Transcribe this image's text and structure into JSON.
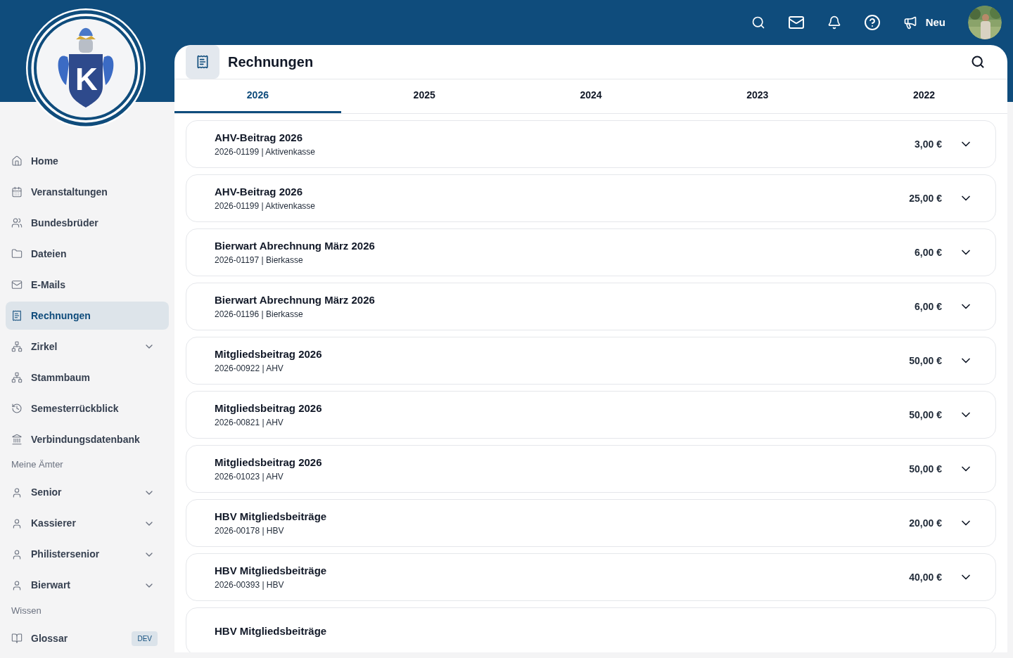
{
  "logo": {
    "letter": "K"
  },
  "sidebar": {
    "sections": [
      {
        "items": [
          {
            "label": "Home",
            "selected": false,
            "expandable": false
          },
          {
            "label": "Veranstaltungen",
            "selected": false,
            "expandable": false
          },
          {
            "label": "Bundesbrüder",
            "selected": false,
            "expandable": false
          },
          {
            "label": "Dateien",
            "selected": false,
            "expandable": false
          },
          {
            "label": "E-Mails",
            "selected": false,
            "expandable": false
          },
          {
            "label": "Rechnungen",
            "selected": true,
            "expandable": false
          },
          {
            "label": "Zirkel",
            "selected": false,
            "expandable": true
          },
          {
            "label": "Stammbaum",
            "selected": false,
            "expandable": false
          },
          {
            "label": "Semesterrückblick",
            "selected": false,
            "expandable": false
          },
          {
            "label": "Verbindungsdatenbank",
            "selected": false,
            "expandable": false
          }
        ]
      },
      {
        "heading": "Meine Ämter",
        "items": [
          {
            "label": "Senior",
            "selected": false,
            "expandable": true
          },
          {
            "label": "Kassierer",
            "selected": false,
            "expandable": true
          },
          {
            "label": "Philistersenior",
            "selected": false,
            "expandable": true
          },
          {
            "label": "Bierwart",
            "selected": false,
            "expandable": true
          }
        ]
      },
      {
        "heading": "Wissen",
        "items": [
          {
            "label": "Glossar",
            "selected": false,
            "expandable": false,
            "badge": "DEV"
          }
        ]
      }
    ]
  },
  "topbar": {
    "new_label": "Neu"
  },
  "page": {
    "title": "Rechnungen",
    "tabs": [
      {
        "label": "2026",
        "selected": true
      },
      {
        "label": "2025",
        "selected": false
      },
      {
        "label": "2024",
        "selected": false
      },
      {
        "label": "2023",
        "selected": false
      },
      {
        "label": "2022",
        "selected": false
      }
    ],
    "invoices": [
      {
        "title": "AHV-Beitrag 2026",
        "subtitle": "2026-01199 | Aktivenkasse",
        "amount": "3,00 €"
      },
      {
        "title": "AHV-Beitrag 2026",
        "subtitle": "2026-01199 | Aktivenkasse",
        "amount": "25,00 €"
      },
      {
        "title": "Bierwart Abrechnung März 2026",
        "subtitle": "2026-01197 | Bierkasse",
        "amount": "6,00 €"
      },
      {
        "title": "Bierwart Abrechnung März 2026",
        "subtitle": "2026-01196 | Bierkasse",
        "amount": "6,00 €"
      },
      {
        "title": "Mitgliedsbeitrag 2026",
        "subtitle": "2026-00922 | AHV",
        "amount": "50,00 €"
      },
      {
        "title": "Mitgliedsbeitrag 2026",
        "subtitle": "2026-00821 | AHV",
        "amount": "50,00 €"
      },
      {
        "title": "Mitgliedsbeitrag 2026",
        "subtitle": "2026-01023 | AHV",
        "amount": "50,00 €"
      },
      {
        "title": "HBV Mitgliedsbeiträge",
        "subtitle": "2026-00178 | HBV",
        "amount": "20,00 €"
      },
      {
        "title": "HBV Mitgliedsbeiträge",
        "subtitle": "2026-00393 | HBV",
        "amount": "40,00 €"
      },
      {
        "title": "HBV Mitgliedsbeiträge"
      }
    ]
  }
}
